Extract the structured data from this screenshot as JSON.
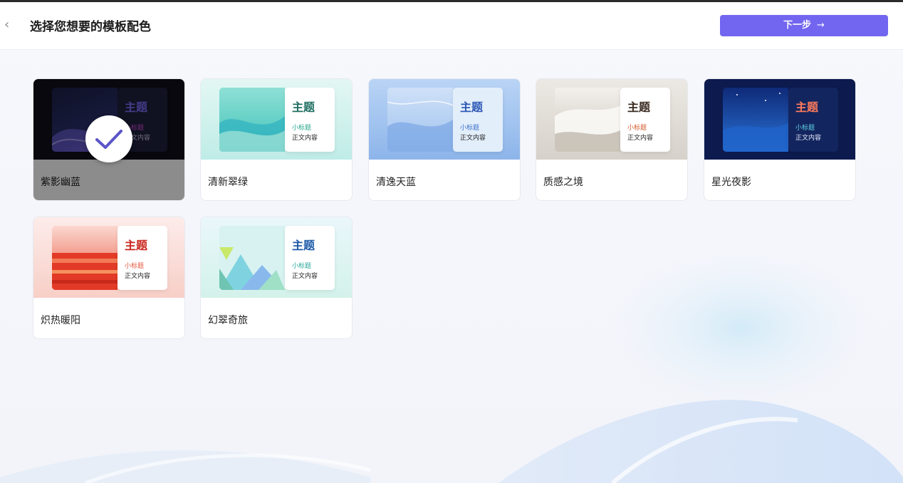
{
  "header": {
    "back_icon": "chevron-left-icon",
    "back_glyph": "‹",
    "title": "选择您想要的模板配色",
    "next_label": "下一步",
    "next_arrow": "→",
    "next_color": "#7266f0"
  },
  "templates": [
    {
      "name": "紫影幽蓝",
      "title": "主题",
      "subtitle": "小标题",
      "body": "正文内容",
      "selected": true
    },
    {
      "name": "清新翠绿",
      "title": "主题",
      "subtitle": "小标题",
      "body": "正文内容",
      "selected": false
    },
    {
      "name": "清逸天蓝",
      "title": "主题",
      "subtitle": "小标题",
      "body": "正文内容",
      "selected": false
    },
    {
      "name": "质感之境",
      "title": "主题",
      "subtitle": "小标题",
      "body": "正文内容",
      "selected": false
    },
    {
      "name": "星光夜影",
      "title": "主题",
      "subtitle": "小标题",
      "body": "正文内容",
      "selected": false
    },
    {
      "name": "炽热暖阳",
      "title": "主题",
      "subtitle": "小标题",
      "body": "正文内容",
      "selected": false
    },
    {
      "name": "幻翠奇旅",
      "title": "主题",
      "subtitle": "小标题",
      "body": "正文内容",
      "selected": false
    }
  ],
  "selected_icon": "checkmark-icon"
}
